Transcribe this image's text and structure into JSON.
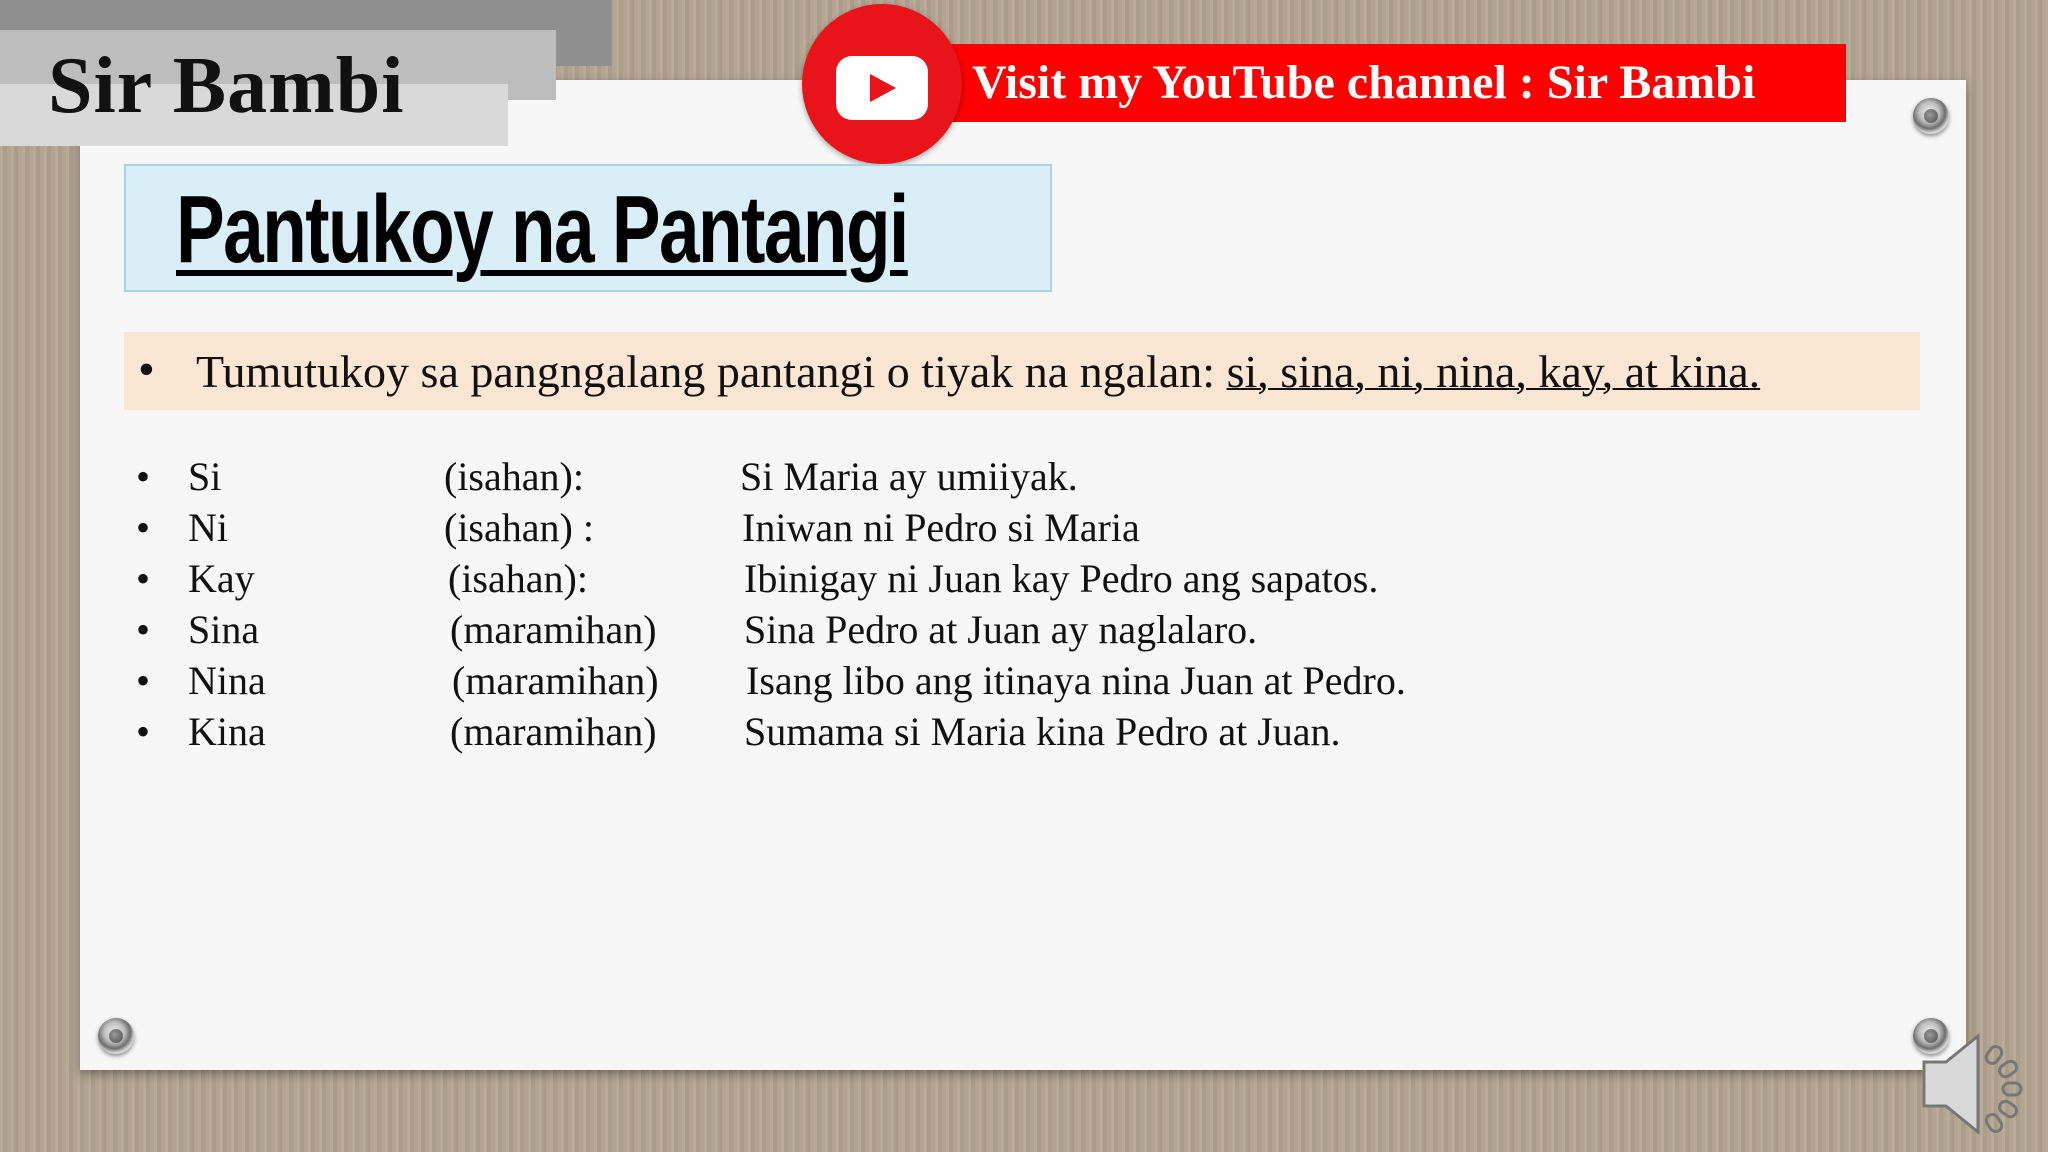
{
  "brand": {
    "label": "Sir Bambi"
  },
  "youtube": {
    "text": "Visit my YouTube channel : Sir Bambi",
    "icon": "youtube-play-icon",
    "color": "#ff0000"
  },
  "slide": {
    "title": "Pantukoy na Pantangi",
    "definition": {
      "bullet": "•",
      "text": "Tumutukoy sa pangngalang pantangi o tiyak na ngalan: ",
      "underlined": "si, sina, ni, nina, kay, at kina."
    },
    "rows": [
      {
        "bullet": "•",
        "word": "Si",
        "number": "(isahan):",
        "example": "Si Maria ay umiiyak."
      },
      {
        "bullet": "•",
        "word": "Ni",
        "number": "(isahan) :",
        "example": "Iniwan ni Pedro si Maria"
      },
      {
        "bullet": "•",
        "word": "Kay",
        "number": "(isahan):",
        "example": "Ibinigay ni Juan kay Pedro ang sapatos."
      },
      {
        "bullet": "•",
        "word": "Sina",
        "number": "(maramihan)",
        "example": "Sina Pedro at Juan ay naglalaro."
      },
      {
        "bullet": "•",
        "word": "Nina",
        "number": "(maramihan)",
        "example": "Isang libo ang itinaya nina Juan at Pedro."
      },
      {
        "bullet": "•",
        "word": "Kina",
        "number": "(maramihan)",
        "example": "Sumama si Maria kina Pedro at Juan."
      }
    ]
  },
  "icons": {
    "pin": "pushpin-icon",
    "speaker": "speaker-audio-icon"
  }
}
